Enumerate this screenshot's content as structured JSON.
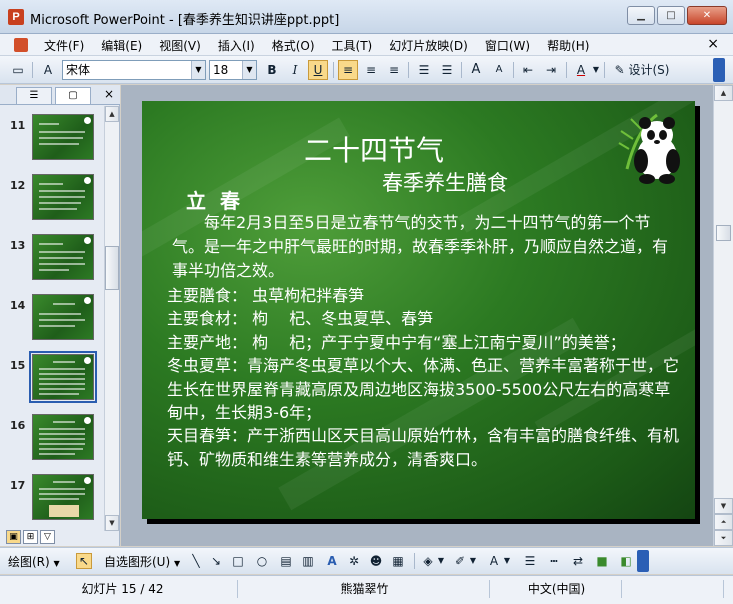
{
  "window": {
    "title": "Microsoft PowerPoint - [春季养生知识讲座ppt.ppt]",
    "app_icon_letter": "P",
    "min_glyph": "▁",
    "max_glyph": "□",
    "close_glyph": "✕"
  },
  "menu": {
    "items": [
      "文件(F)",
      "编辑(E)",
      "视图(V)",
      "插入(I)",
      "格式(O)",
      "工具(T)",
      "幻灯片放映(D)",
      "窗口(W)",
      "帮助(H)"
    ],
    "close_glyph": "×"
  },
  "toolbar": {
    "font_name": "宋体",
    "font_size": "18",
    "bold": "B",
    "italic": "I",
    "underline": "U",
    "design_label": "设计(S)"
  },
  "panel": {
    "close_glyph": "×",
    "thumbnails": [
      {
        "number": "11"
      },
      {
        "number": "12"
      },
      {
        "number": "13"
      },
      {
        "number": "14"
      },
      {
        "number": "15",
        "selected": true
      },
      {
        "number": "16"
      },
      {
        "number": "17"
      }
    ]
  },
  "slide": {
    "title": "二十四节气",
    "subtitle": "春季养生膳食",
    "heading": "立春",
    "paragraph": "每年2月3日至5日是立春节气的交节，为二十四节气的第一个节气。是一年之中肝气最旺的时期，故春季季补肝，乃顺应自然之道，有事半功倍之效。",
    "list": [
      "主要膳食：  虫草枸杞拌春笋",
      "主要食材：  枸　 杞、冬虫夏草、春笋",
      "主要产地：  枸　 杞；产于宁夏中宁有“塞上江南宁夏川”的美誉；",
      "冬虫夏草：青海产冬虫夏草以个大、体满、色正、营养丰富著称于世，它生长在世界屋脊青藏高原及周边地区海拔3500-5500公尺左右的高寒草甸中，生长期3-6年；",
      "天目春笋：产于浙西山区天目高山原始竹林，含有丰富的膳食纤维、有机钙、矿物质和维生素等营养成分，清香爽口。"
    ]
  },
  "drawbar": {
    "draw_label": "绘图(R)",
    "autoshapes_label": "自选图形(U)"
  },
  "status": {
    "slide_info": "幻灯片 15 / 42",
    "design_name": "熊猫翠竹",
    "language": "中文(中国)"
  },
  "colors": {
    "slide_green": "#2c7a22",
    "selection_blue": "#2a5db0",
    "pressed_button": "#f9d98a"
  }
}
